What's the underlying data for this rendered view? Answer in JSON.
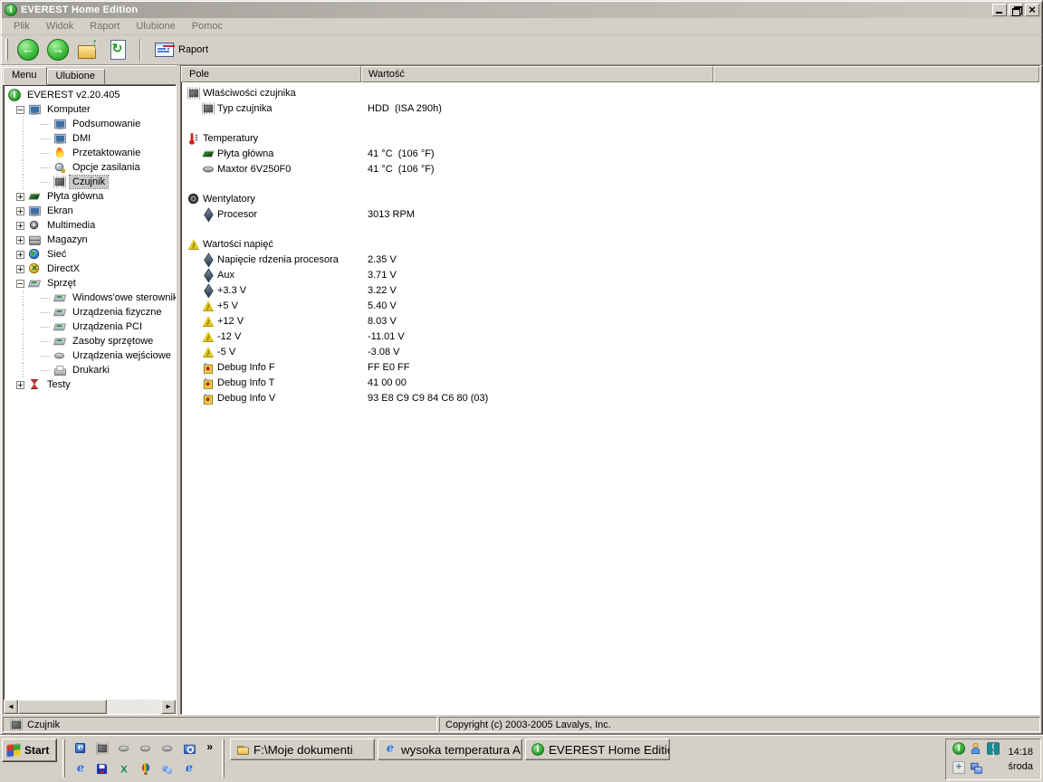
{
  "window": {
    "title": "EVEREST Home Edition"
  },
  "menu_bar": {
    "items": [
      "Plik",
      "Widok",
      "Raport",
      "Ulubione",
      "Pomoc"
    ]
  },
  "toolbar": {
    "report_label": "Raport"
  },
  "sidebar": {
    "tabs": [
      {
        "label": "Menu",
        "active": true
      },
      {
        "label": "Ulubione",
        "active": false
      }
    ],
    "tree": [
      {
        "label": "EVEREST v2.20.405",
        "icon": "info-icon",
        "level": 0,
        "expand": null
      },
      {
        "label": "Komputer",
        "icon": "computer-icon",
        "level": 1,
        "expand": "minus"
      },
      {
        "label": "Podsumowanie",
        "icon": "computer-icon",
        "level": 2,
        "expand": null
      },
      {
        "label": "DMI",
        "icon": "computer-icon",
        "level": 2,
        "expand": null
      },
      {
        "label": "Przetaktowanie",
        "icon": "flame-icon",
        "level": 2,
        "expand": null
      },
      {
        "label": "Opcje zasilania",
        "icon": "power-icon",
        "level": 2,
        "expand": null
      },
      {
        "label": "Czujnik",
        "icon": "chip-icon",
        "level": 2,
        "expand": null,
        "selected": true
      },
      {
        "label": "Płyta główna",
        "icon": "motherboard-icon",
        "level": 1,
        "expand": "plus"
      },
      {
        "label": "Ekran",
        "icon": "display-icon",
        "level": 1,
        "expand": "plus"
      },
      {
        "label": "Multimedia",
        "icon": "multimedia-icon",
        "level": 1,
        "expand": "plus"
      },
      {
        "label": "Magazyn",
        "icon": "storage-icon",
        "level": 1,
        "expand": "plus"
      },
      {
        "label": "Sieć",
        "icon": "network-icon",
        "level": 1,
        "expand": "plus"
      },
      {
        "label": "DirectX",
        "icon": "directx-icon",
        "level": 1,
        "expand": "plus"
      },
      {
        "label": "Sprzęt",
        "icon": "devices-icon",
        "level": 1,
        "expand": "minus"
      },
      {
        "label": "Windows'owe sterowniki u",
        "icon": "devices-icon",
        "level": 2,
        "expand": null
      },
      {
        "label": "Urządzenia fizyczne",
        "icon": "devices-icon",
        "level": 2,
        "expand": null
      },
      {
        "label": "Urządzenia PCI",
        "icon": "devices-icon",
        "level": 2,
        "expand": null
      },
      {
        "label": "Zasoby sprzętowe",
        "icon": "devices-icon",
        "level": 2,
        "expand": null
      },
      {
        "label": "Urządzenia wejściowe",
        "icon": "mouse-icon",
        "level": 2,
        "expand": null
      },
      {
        "label": "Drukarki",
        "icon": "printer-icon",
        "level": 2,
        "expand": null
      },
      {
        "label": "Testy",
        "icon": "test-icon",
        "level": 1,
        "expand": "plus"
      }
    ]
  },
  "main": {
    "columns": [
      "Pole",
      "Wartość"
    ],
    "rows": [
      {
        "type": "section",
        "label": "Właściwości czujnika",
        "icon": "chip-icon"
      },
      {
        "type": "item",
        "label": "Typ czujnika",
        "icon": "chip-icon",
        "value": "HDD  (ISA 290h)"
      },
      {
        "type": "spacer"
      },
      {
        "type": "section",
        "label": "Temperatury",
        "icon": "thermometer-icon"
      },
      {
        "type": "item",
        "label": "Płyta główna",
        "icon": "motherboard-icon",
        "value": "41 °C  (106 °F)"
      },
      {
        "type": "item",
        "label": "Maxtor 6V250F0",
        "icon": "hdd-icon",
        "value": "41 °C  (106 °F)"
      },
      {
        "type": "spacer"
      },
      {
        "type": "section",
        "label": "Wentylatory",
        "icon": "fan-icon"
      },
      {
        "type": "item",
        "label": "Procesor",
        "icon": "cpu-icon",
        "value": "3013 RPM"
      },
      {
        "type": "spacer"
      },
      {
        "type": "section",
        "label": "Wartości napięć",
        "icon": "voltage-icon"
      },
      {
        "type": "item",
        "label": "Napięcie rdzenia procesora",
        "icon": "cpu-icon",
        "value": "2.35 V"
      },
      {
        "type": "item",
        "label": "Aux",
        "icon": "cpu-icon",
        "value": "3.71 V"
      },
      {
        "type": "item",
        "label": "+3.3 V",
        "icon": "cpu-icon",
        "value": "3.22 V"
      },
      {
        "type": "item",
        "label": "+5 V",
        "icon": "voltage-icon",
        "value": "5.40 V"
      },
      {
        "type": "item",
        "label": "+12 V",
        "icon": "voltage-icon",
        "value": "8.03 V"
      },
      {
        "type": "item",
        "label": "-12 V",
        "icon": "voltage-icon",
        "value": "-11.01 V"
      },
      {
        "type": "item",
        "label": "-5 V",
        "icon": "voltage-icon",
        "value": "-3.08 V"
      },
      {
        "type": "item",
        "label": "Debug Info F",
        "icon": "debug-icon",
        "value": "FF E0 FF"
      },
      {
        "type": "item",
        "label": "Debug Info T",
        "icon": "debug-icon",
        "value": "41 00 00"
      },
      {
        "type": "item",
        "label": "Debug Info V",
        "icon": "debug-icon",
        "value": "93 E8 C9 C9 84 C6 80 (03)"
      }
    ]
  },
  "status_bar": {
    "left": "Czujnik",
    "right": "Copyright (c) 2003-2005 Lavalys, Inc."
  },
  "taskbar": {
    "start_label": "Start",
    "overflow_chevron": "»",
    "quick_launch_row1": [
      "outlook-express-icon",
      "chip-icon",
      "mouse-icon",
      "mouse-icon",
      "mouse-icon",
      "search-folder-icon"
    ],
    "quick_launch_row2": [
      "ie-icon",
      "save-icon",
      "excel-icon",
      "balloon-icon",
      "netmeeting-icon",
      "ie-icon"
    ],
    "buttons": [
      {
        "label": "F:\\Moje dokumenti",
        "icon": "folder-icon"
      },
      {
        "label": "wysoka temperatura AU...",
        "icon": "ie-icon"
      },
      {
        "label": "EVEREST Home Edition",
        "icon": "info-icon"
      }
    ],
    "tray": {
      "icons_row1": [
        "everest-tray-icon",
        "user-icon",
        "teal-app-icon"
      ],
      "icons_row2": [
        "crosshair-icon",
        "network-tray-icon"
      ],
      "time": "14:18",
      "day": "środa"
    }
  },
  "colors": {
    "base": "#d4d0c8",
    "accent_green": "#2ca02c",
    "selection": "#c9c9c9",
    "titlebar": "#a8a6a0"
  }
}
